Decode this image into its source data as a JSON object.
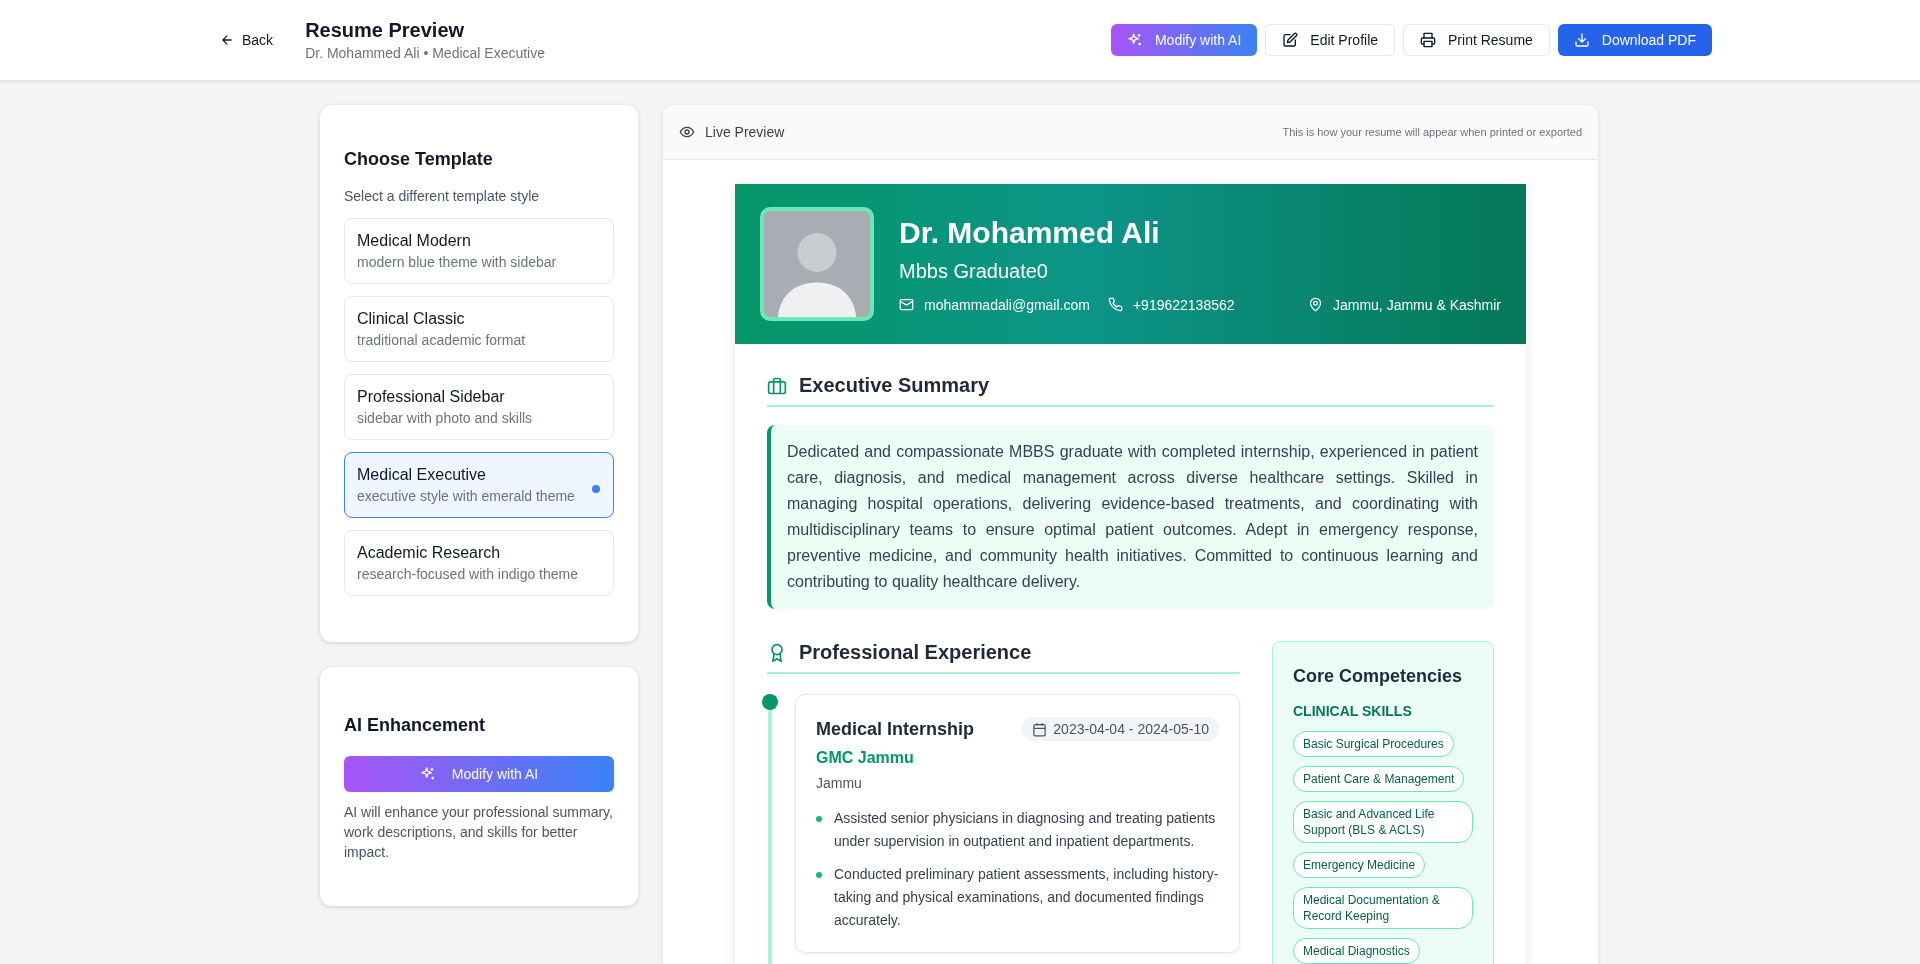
{
  "header": {
    "back": "Back",
    "title": "Resume Preview",
    "subtitle": "Dr. Mohammed Ali • Medical Executive",
    "actions": [
      {
        "label": "Modify with AI",
        "kind": "ai"
      },
      {
        "label": "Edit Profile",
        "kind": "edit"
      },
      {
        "label": "Print Resume",
        "kind": "print"
      },
      {
        "label": "Download PDF",
        "kind": "download"
      }
    ]
  },
  "templates": {
    "title": "Choose Template",
    "subtitle": "Select a different template style",
    "items": [
      {
        "name": "Medical Modern",
        "description": "modern blue theme with sidebar",
        "selected": false
      },
      {
        "name": "Clinical Classic",
        "description": "traditional academic format",
        "selected": false
      },
      {
        "name": "Professional Sidebar",
        "description": "sidebar with photo and skills",
        "selected": false
      },
      {
        "name": "Medical Executive",
        "description": "executive style with emerald theme",
        "selected": true
      },
      {
        "name": "Academic Research",
        "description": "research-focused with indigo theme",
        "selected": false
      }
    ]
  },
  "ai": {
    "title": "AI Enhancement",
    "button": "Modify with AI",
    "description": "AI will enhance your professional summary, work descriptions, and skills for better impact."
  },
  "preview": {
    "title": "Live Preview",
    "note": "This is how your resume will appear when printed or exported",
    "resume": {
      "name": "Dr. Mohammed Ali",
      "headline": "Mbbs Graduate0",
      "contacts": [
        {
          "kind": "email",
          "text": "mohammadali@gmail.com"
        },
        {
          "kind": "phone",
          "text": "+919622138562"
        },
        {
          "kind": "location",
          "text": "Jammu, Jammu & Kashmir"
        }
      ],
      "summary": {
        "title": "Executive Summary",
        "text": "Dedicated and compassionate MBBS graduate with completed internship, experienced in patient care, diagnosis, and medical management across diverse healthcare settings. Skilled in managing hospital operations, delivering evidence-based treatments, and coordinating with multidisciplinary teams to ensure optimal patient outcomes. Adept in emergency response, preventive medicine, and community health initiatives. Committed to continuous learning and contributing to quality healthcare delivery."
      },
      "experience": {
        "title": "Professional Experience",
        "items": [
          {
            "role": "Medical Internship",
            "dates": "2023-04-04 - 2024-05-10",
            "organization": "GMC Jammu",
            "location": "Jammu",
            "bullets": [
              "Assisted senior physicians in diagnosing and treating patients under supervision in outpatient and inpatient departments.",
              "Conducted preliminary patient assessments, including history-taking and physical examinations, and documented findings accurately."
            ]
          }
        ]
      },
      "competencies": {
        "title": "Core Competencies",
        "groups": [
          {
            "title": "CLINICAL SKILLS",
            "skills": [
              "Basic Surgical Procedures",
              "Patient Care & Management",
              "Basic and Advanced Life Support (BLS & ACLS)",
              "Emergency Medicine",
              "Medical Documentation & Record Keeping",
              "Medical Diagnostics"
            ]
          }
        ]
      }
    }
  }
}
